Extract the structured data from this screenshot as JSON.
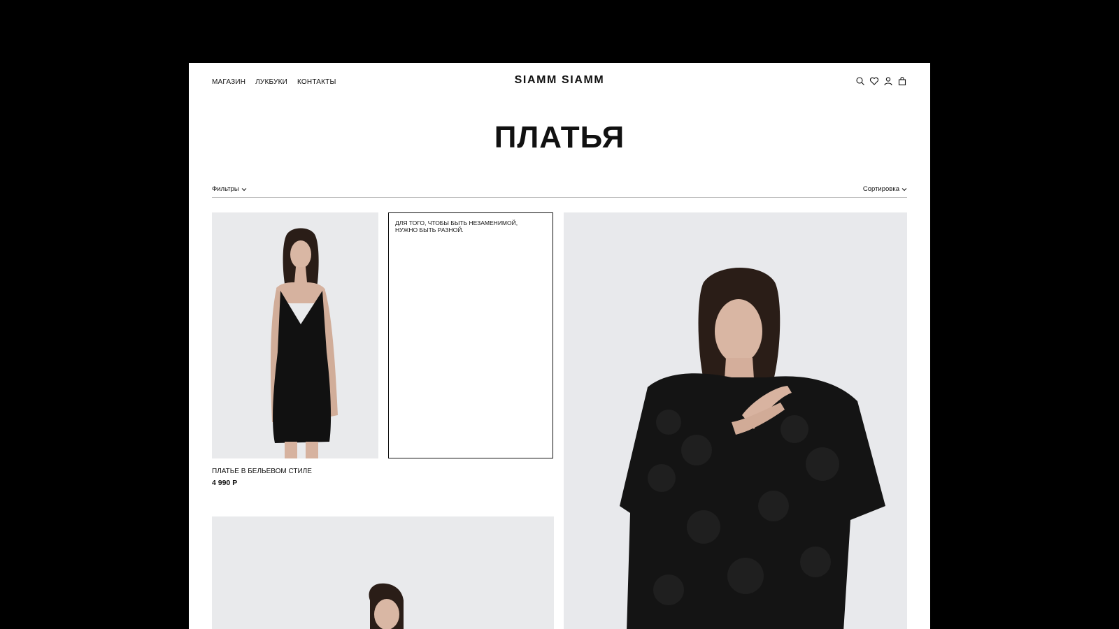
{
  "header": {
    "nav": [
      "МАГАЗИН",
      "ЛУКБУКИ",
      "КОНТАКТЫ"
    ],
    "logo": "SIAMM SIAMM",
    "icons": [
      "search-icon",
      "heart-icon",
      "user-icon",
      "bag-icon"
    ]
  },
  "page_title": "ПЛАТЬЯ",
  "toolbar": {
    "filters_label": "Фильтры",
    "sort_label": "Сортировка"
  },
  "quote": "ДЛЯ ТОГО, ЧТОБЫ БЫТЬ НЕЗАМЕНИМОЙ,\nНУЖНО БЫТЬ РАЗНОЙ.",
  "products": [
    {
      "name": "ПЛАТЬЕ В БЕЛЬЕВОМ СТИЛЕ",
      "price": "4 990 Р"
    }
  ],
  "colors": {
    "outer_background": "#000000",
    "page_background": "#ffffff",
    "text": "#111111",
    "photo_background": "#e9eaec"
  }
}
